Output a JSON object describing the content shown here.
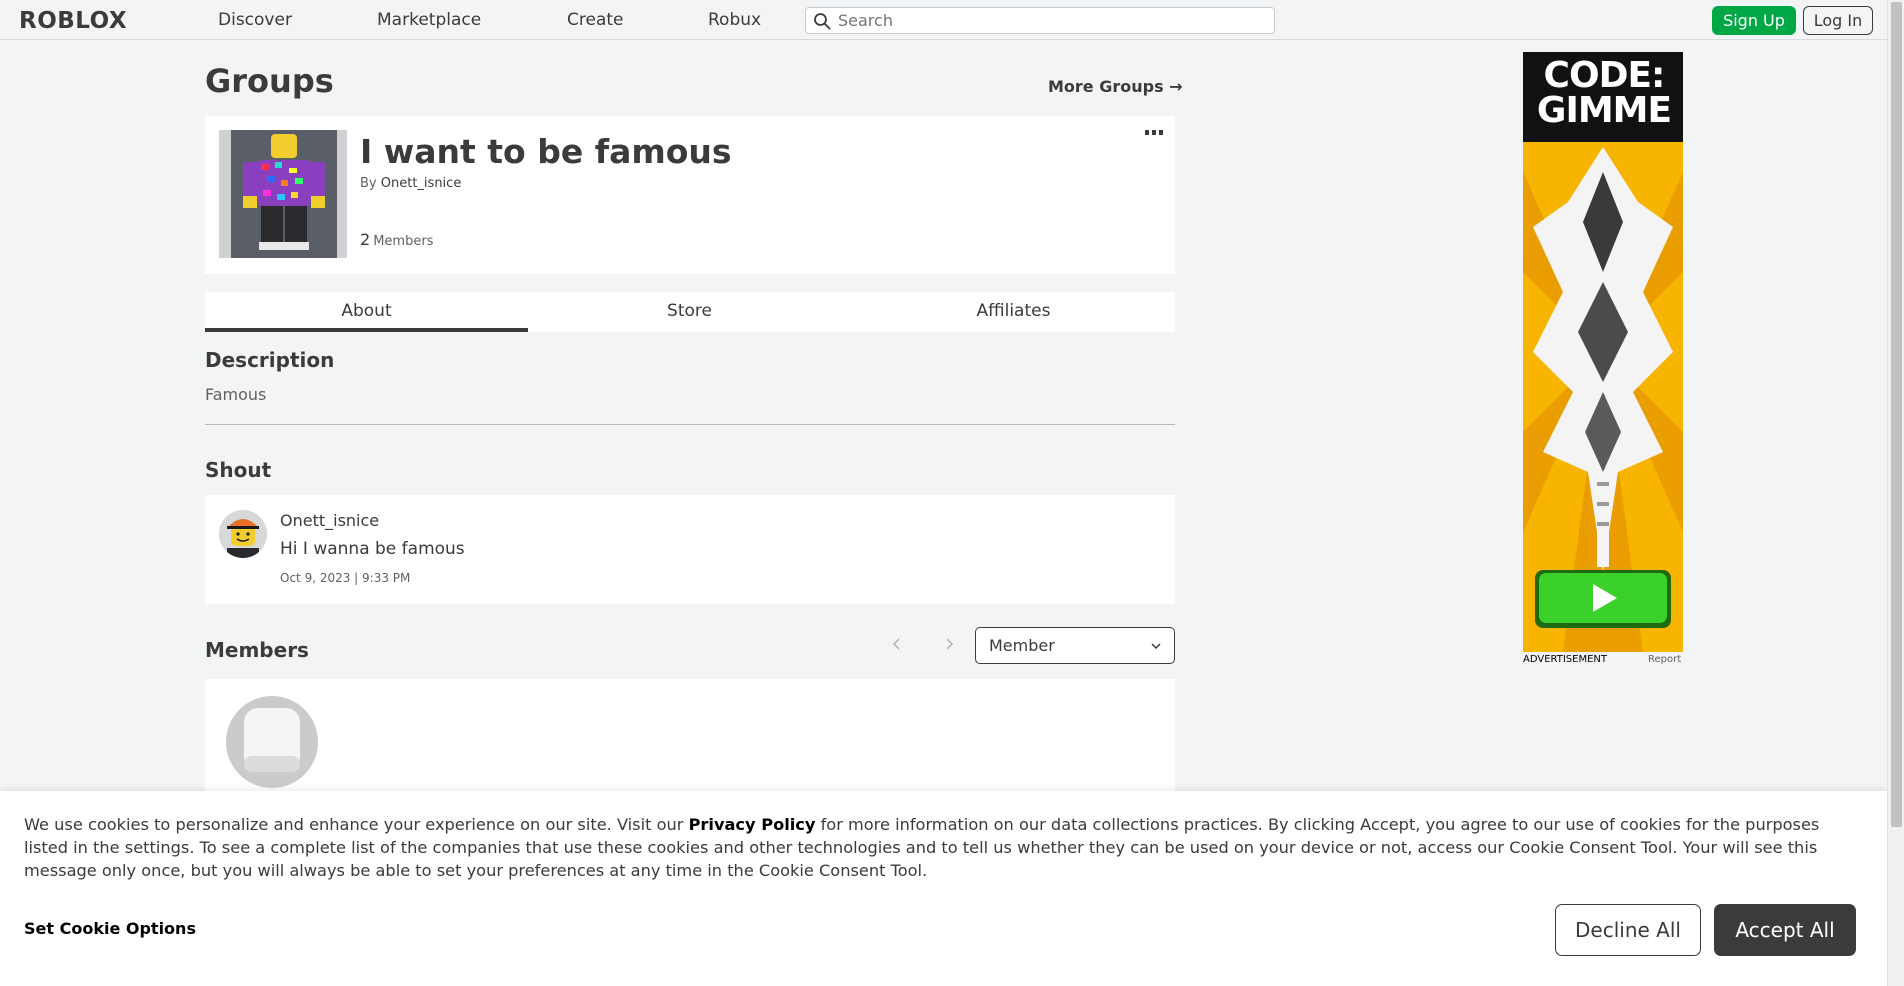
{
  "nav": {
    "logo": "ROBLOX",
    "links": [
      "Discover",
      "Marketplace",
      "Create",
      "Robux"
    ],
    "search_placeholder": "Search",
    "signup": "Sign Up",
    "login": "Log In"
  },
  "page": {
    "title": "Groups",
    "more_groups": "More Groups →"
  },
  "group": {
    "name": "I want to be famous",
    "by_prefix": "By",
    "owner": "Onett_isnice",
    "member_count": "2",
    "member_label": "Members"
  },
  "tabs": [
    "About",
    "Store",
    "Affiliates"
  ],
  "about": {
    "description_heading": "Description",
    "description": "Famous",
    "shout_heading": "Shout",
    "shout": {
      "user": "Onett_isnice",
      "message": "Hi I wanna be famous",
      "time": "Oct 9, 2023 | 9:33 PM"
    },
    "members_heading": "Members",
    "role_select": "Member"
  },
  "ad": {
    "headline": "CODE: GIMME",
    "label": "ADVERTISEMENT",
    "report": "Report"
  },
  "cookie": {
    "text_before": "We use cookies to personalize and enhance your experience on our site. Visit our ",
    "privacy_link": "Privacy Policy",
    "text_after": " for more information on our data collections practices. By clicking Accept, you agree to our use of cookies for the purposes listed in the settings. To see a complete list of the companies that use these cookies and other technologies and to tell us whether they can be used on your device or not, access our Cookie Consent Tool. Your will see this message only once, but you will always be able to set your preferences at any time in the Cookie Consent Tool.",
    "options": "Set Cookie Options",
    "decline": "Decline All",
    "accept": "Accept All"
  },
  "colors": {
    "accent_green": "#00a845",
    "text_dark": "#393b3d",
    "background": "#f2f4f5"
  }
}
